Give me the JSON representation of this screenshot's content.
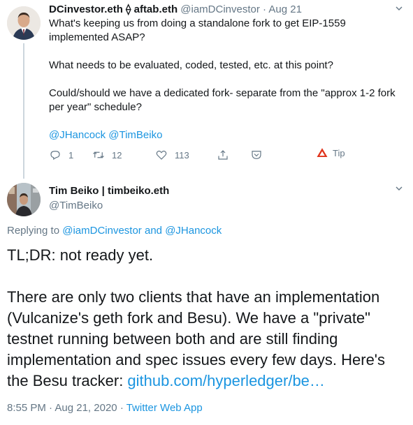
{
  "tweet1": {
    "display_name": "DCinvestor.eth ⟠ aftab.eth",
    "handle": "@iamDCinvestor",
    "separator": "·",
    "date": "Aug 21",
    "paragraphs": [
      "What's keeping us from doing a standalone fork to get EIP-1559 implemented ASAP?",
      "What needs to be evaluated, coded, tested, etc. at this point?",
      "Could/should we have a dedicated fork- separate from the \"approx 1-2 fork per year\" schedule?"
    ],
    "mentions": "@JHancock @TimBeiko",
    "actions": {
      "replies": "1",
      "retweets": "12",
      "likes": "113",
      "tip_label": "Tip"
    }
  },
  "tweet2": {
    "display_name": "Tim Beiko | timbeiko.eth",
    "handle": "@TimBeiko",
    "replying_prefix": "Replying to",
    "replying_user1": "@iamDCinvestor",
    "replying_and": "and",
    "replying_user2": "@JHancock",
    "text_line1": "TL;DR: not ready yet.",
    "text_para2": "There are only two clients that have an implementation (Vulcanize's geth fork and Besu). We have a \"private\" testnet running between both and are still finding implementation and spec issues every few days. Here's the Besu tracker: ",
    "link": "github.com/hyperledger/be…",
    "time": "8:55 PM",
    "date": "Aug 21, 2020",
    "source": "Twitter Web App",
    "dot": "·"
  },
  "icons": {
    "reply": "reply-icon",
    "retweet": "retweet-icon",
    "like": "heart-icon",
    "share": "share-icon",
    "pocket": "pocket-icon",
    "tip": "brave-triangle-icon",
    "more": "chevron-down-icon"
  },
  "colors": {
    "link": "#1b95e0",
    "muted": "#657786",
    "text": "#14171a",
    "thread_line": "#ccd6dd",
    "tip_red": "#e0331b"
  }
}
